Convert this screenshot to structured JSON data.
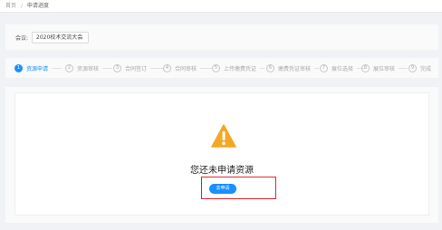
{
  "breadcrumb": {
    "home": "首页",
    "separator": "/",
    "current": "申请进度"
  },
  "meeting": {
    "label": "会议:",
    "selected": "2020校术交流大会",
    "chevron_icon": "chevron-down-icon"
  },
  "steps": [
    {
      "num": "1",
      "label": "资源申请",
      "active": true
    },
    {
      "num": "2",
      "label": "资源审核",
      "active": false
    },
    {
      "num": "3",
      "label": "合同签订",
      "active": false
    },
    {
      "num": "4",
      "label": "合同审核",
      "active": false
    },
    {
      "num": "5",
      "label": "上传缴费凭证",
      "active": false
    },
    {
      "num": "6",
      "label": "缴费凭证审核",
      "active": false
    },
    {
      "num": "7",
      "label": "展位选择",
      "active": false
    },
    {
      "num": "8",
      "label": "展位审核",
      "active": false
    },
    {
      "num": "9",
      "label": "完成",
      "active": false
    }
  ],
  "empty_state": {
    "icon": "warning-icon",
    "message": "您还未申请资源",
    "button_label": "去申请"
  },
  "colors": {
    "accent": "#1890ff",
    "warning": "#f5a623",
    "highlight": "#e3242b"
  }
}
